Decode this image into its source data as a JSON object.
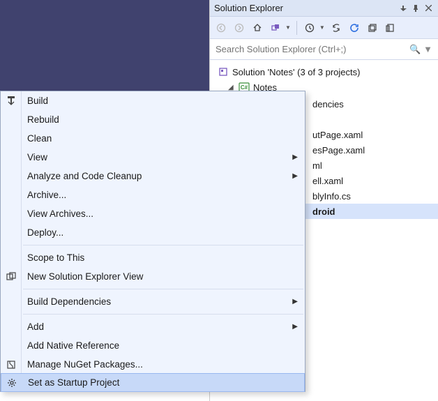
{
  "panel": {
    "title": "Solution Explorer",
    "search_placeholder": "Search Solution Explorer (Ctrl+;)"
  },
  "tree": {
    "solution": "Solution 'Notes' (3 of 3 projects)",
    "project": "Notes",
    "items": {
      "deps": "dencies",
      "about": "utPage.xaml",
      "notes": "esPage.xaml",
      "ml": "ml",
      "shell": "ell.xaml",
      "assembly": "blyInfo.cs",
      "droid": "droid"
    }
  },
  "menu": {
    "build": "Build",
    "rebuild": "Rebuild",
    "clean": "Clean",
    "view": "View",
    "analyze": "Analyze and Code Cleanup",
    "archive": "Archive...",
    "view_archives": "View Archives...",
    "deploy": "Deploy...",
    "scope": "Scope to This",
    "new_view": "New Solution Explorer View",
    "build_deps": "Build Dependencies",
    "add": "Add",
    "add_native": "Add Native Reference",
    "nuget": "Manage NuGet Packages...",
    "startup": "Set as Startup Project"
  }
}
